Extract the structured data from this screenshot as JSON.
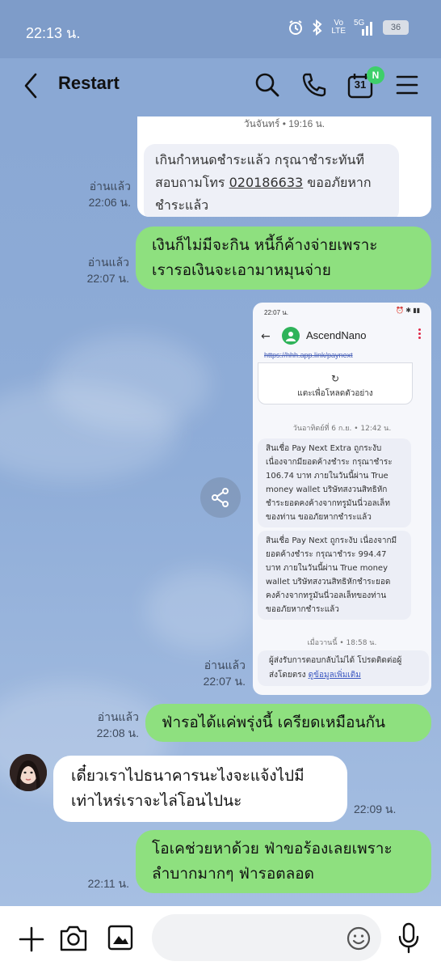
{
  "status_bar": {
    "time": "22:13 น.",
    "volte_top": "Vo",
    "volte_bottom": "LTE",
    "network": "5G",
    "battery": "36"
  },
  "header": {
    "title": "Restart",
    "calendar_day": "31",
    "calendar_badge": "N"
  },
  "messages": [
    {
      "read_label": "อ่านแล้ว",
      "time": "22:06 น.",
      "forwarded_card": {
        "date": "วันจันทร์ • 19:16 น.",
        "text_line1": "เกินกำหนดชำระแล้ว กรุณาชำระทันที",
        "text_line2_pre": "สอบถามโทร ",
        "phone": "020186633",
        "text_line2_post": " ขออภัยหาก",
        "text_line3": "ชำระแล้ว"
      }
    },
    {
      "read_label": "อ่านแล้ว",
      "time": "22:07 น.",
      "line1": "เงินก็ไม่มีจะกิน หนี้ก็ค้างจ่ายเพราะ",
      "line2": "เรารอเงินจะเอามาหมุนจ่าย"
    },
    {
      "read_label": "อ่านแล้ว",
      "time": "22:07 น.",
      "screenshot": {
        "status_time": "22:07 น.",
        "contact": "AscendNano",
        "link_text": "https://hhh.app.link/paynext",
        "reload_label": "แตะเพื่อโหลดตัวอย่าง",
        "date1": "วันอาทิตย์ที่ 6 ก.ย. • 12:42 น.",
        "msg1": [
          "สินเชื่อ Pay Next Extra ถูกระงับ",
          "เนื่องจากมียอดค้างชำระ กรุณาชำระ",
          "106.74 บาท ภายในวันนี้ผ่าน True",
          "money wallet บริษัทสงวนสิทธิหัก",
          "ชำระยอดคงค้างจากทรูมันนี่วอลเล็ท",
          "ของท่าน ขออภัยหากชำระแล้ว"
        ],
        "msg2": [
          "สินเชื่อ Pay Next ถูกระงับ เนื่องจากมี",
          "ยอดค้างชำระ กรุณาชำระ 994.47",
          "บาท ภายในวันนี้ผ่าน True money",
          "wallet บริษัทสงวนสิทธิหักชำระยอด",
          "คงค้างจากทรูมันนี่วอลเล็ทของท่าน",
          "ขออภัยหากชำระแล้ว"
        ],
        "date2": "เมื่อวานนี้ • 18:58 น.",
        "footer_text1": "ผู้ส่งรับการตอบกลับไม่ได้ โปรดติดต่อผู้",
        "footer_text2": "ส่งโดยตรง ",
        "footer_link": "ดูข้อมูลเพิ่มเติม"
      }
    },
    {
      "read_label": "อ่านแล้ว",
      "time": "22:08 น.",
      "line1": "ฟ่ารอได้แค่พรุ่งนี้ เครียดเหมือนกัน"
    },
    {
      "time": "22:09 น.",
      "line1": "เดี๋ยวเราไปธนาคารนะไงจะแจ้งไปมี",
      "line2": "เท่าไหร่เราจะไล่โอนไปนะ"
    },
    {
      "time": "22:11 น.",
      "line1": "โอเคช่วยหาด้วย ฟ่าขอร้องเลยเพราะ",
      "line2": "ลำบากมากๆ ฟ่ารอตลอด"
    }
  ],
  "input_bar": {
    "placeholder": ""
  },
  "colors": {
    "chat_bg": "#8aa8d4",
    "sent_bubble": "#8ee07f",
    "received_bubble": "#ffffff",
    "badge": "#3ecf6a"
  }
}
